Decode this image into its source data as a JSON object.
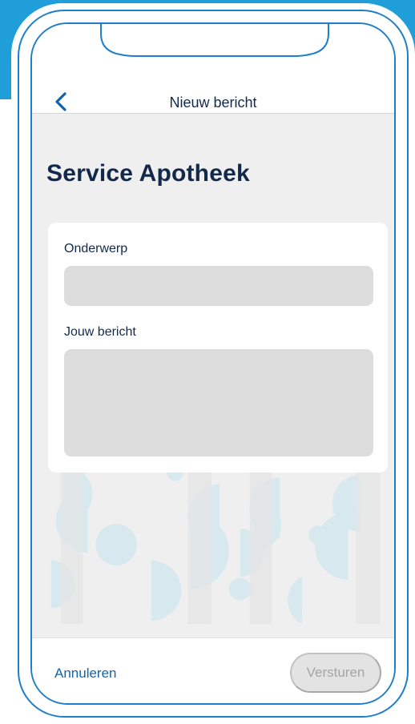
{
  "header": {
    "title": "Nieuw bericht",
    "back_icon": "chevron-left-icon"
  },
  "page": {
    "title": "Service Apotheek"
  },
  "form": {
    "subject_label": "Onderwerp",
    "subject_value": "",
    "message_label": "Jouw bericht",
    "message_value": ""
  },
  "footer": {
    "cancel_label": "Annuleren",
    "send_label": "Versturen",
    "send_enabled": false
  },
  "colors": {
    "brand_navy": "#13294b",
    "link_blue": "#1463a8",
    "frame_blue": "#1e7fc8",
    "accent_blue": "#1f9ed9",
    "pattern_blue": "#cfe4ef"
  }
}
